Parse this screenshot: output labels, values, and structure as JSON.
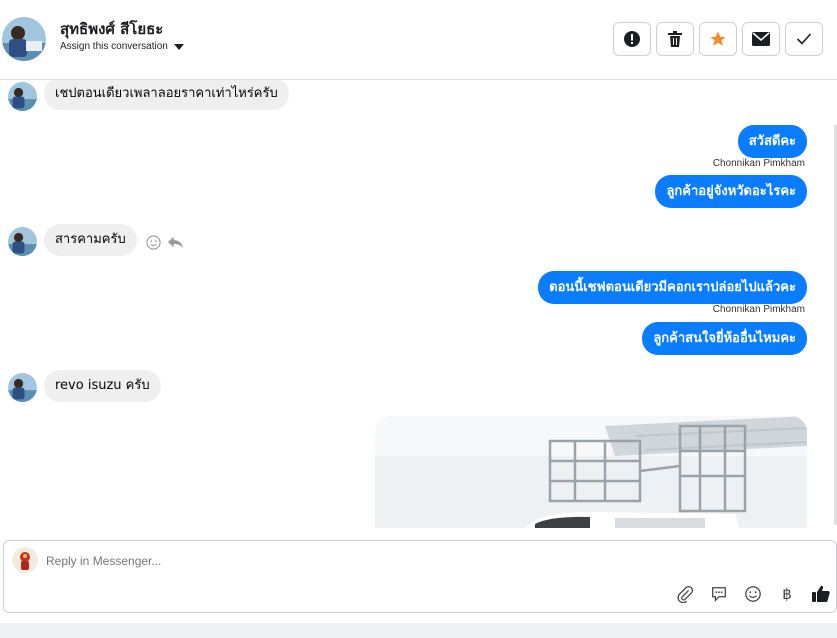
{
  "header": {
    "contact_name": "สุทธิพงศ์ สีโยธะ",
    "assign_label": "Assign this conversation",
    "actions": [
      {
        "name": "spam",
        "icon": "exclamation-icon"
      },
      {
        "name": "delete",
        "icon": "trash-icon"
      },
      {
        "name": "star",
        "icon": "star-icon",
        "color": "#f28c28"
      },
      {
        "name": "unread",
        "icon": "envelope-icon"
      },
      {
        "name": "done",
        "icon": "checkmark-icon"
      }
    ]
  },
  "messages": [
    {
      "dir": "in",
      "text": "เชปตอนเดียวเพลาลอยราคาเท่าไหร่ครับ"
    },
    {
      "dir": "out",
      "text": "สวัสดีคะ",
      "sender": "Chonnikan Pimkham"
    },
    {
      "dir": "out",
      "text": "ลูกค้าอยู่จังหวัดอะไรคะ"
    },
    {
      "dir": "in",
      "text": "สารคามครับ"
    },
    {
      "dir": "out",
      "text": "ตอนนี้เชฟตอนเดียวมีคอกเราปล่อยไปแล้วคะ",
      "sender": "Chonnikan Pimkham"
    },
    {
      "dir": "out",
      "text": "ลูกค้าสนใจยี่ห้ออื่นไหมคะ"
    },
    {
      "dir": "in",
      "text": "revo isuzu ครับ"
    }
  ],
  "composer": {
    "placeholder": "Reply in Messenger...",
    "tools": [
      "paperclip-icon",
      "chat-bubble-icon",
      "emoji-icon",
      "baht-icon",
      "thumbs-up-icon"
    ],
    "baht_symbol": "฿"
  },
  "colors": {
    "accent": "#0a7cff",
    "incoming_bubble": "#efefef",
    "star": "#f28c28"
  }
}
